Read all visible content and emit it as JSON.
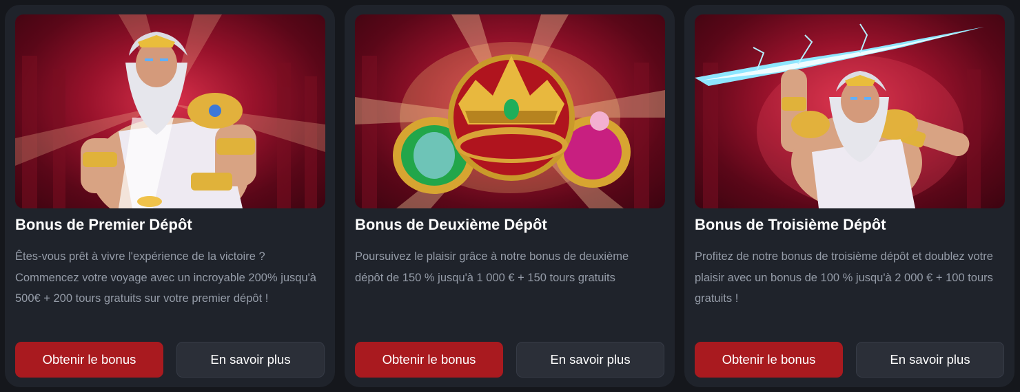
{
  "colors": {
    "page_background": "#15171c",
    "card_background": "#1f232b",
    "primary_button": "#a91a1f",
    "secondary_button": "#2b2f38",
    "title_text": "#ffffff",
    "description_text": "#959ca8"
  },
  "cards": [
    {
      "illustration": "zeus-holding-coins",
      "title": "Bonus de Premier Dépôt",
      "description": "Êtes-vous prêt à vivre l'expérience de la victoire ? Commencez votre voyage avec un incroyable 200% jusqu'à 500€ + 200 tours gratuits sur votre premier dépôt !",
      "primary_button": "Obtenir le bonus",
      "secondary_button": "En savoir plus"
    },
    {
      "illustration": "golden-crown-and-rings",
      "title": "Bonus de Deuxième Dépôt",
      "description": "Poursuivez le plaisir grâce à notre bonus de deuxième dépôt de 150 % jusqu'à 1 000 € + 150 tours gratuits",
      "primary_button": "Obtenir le bonus",
      "secondary_button": "En savoir plus"
    },
    {
      "illustration": "zeus-throwing-lightning",
      "title": "Bonus de Troisième Dépôt",
      "description": "Profitez de notre bonus de troisième dépôt et doublez votre plaisir avec un bonus de 100 % jusqu'à 2 000 € + 100 tours gratuits !",
      "primary_button": "Obtenir le bonus",
      "secondary_button": "En savoir plus"
    }
  ]
}
